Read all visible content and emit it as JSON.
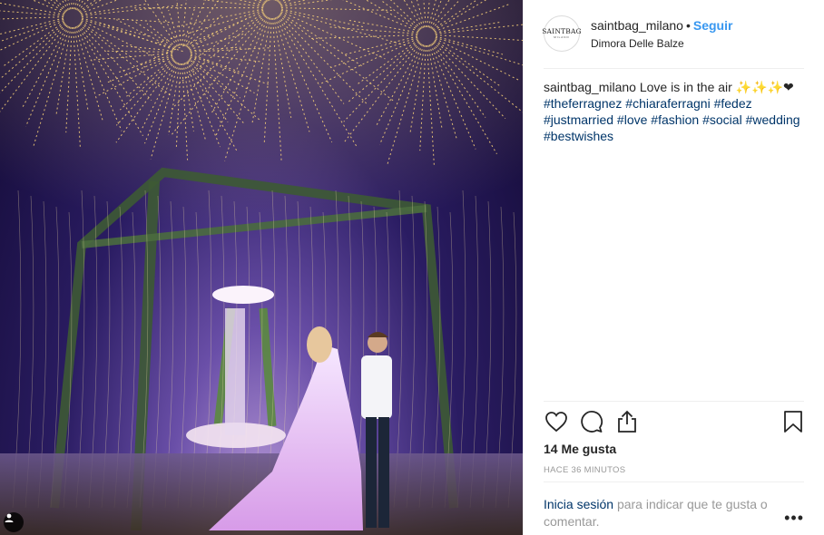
{
  "colors": {
    "link": "#003569",
    "follow": "#3897f0",
    "muted": "#999999",
    "text": "#262626"
  },
  "photo": {
    "tag_icon": "person-tag-icon"
  },
  "header": {
    "avatar_logo": "SAINTBAG",
    "avatar_sub": "MILANO",
    "username": "saintbag_milano",
    "separator": "•",
    "follow_label": "Seguir",
    "location": "Dimora Delle Balze"
  },
  "caption": {
    "username": "saintbag_milano",
    "text": "Love is in the air ✨✨✨❤",
    "hashtags": [
      "#theferragnez",
      "#chiaraferragni",
      "#fedez",
      "#justmarried",
      "#love",
      "#fashion",
      "#social",
      "#wedding",
      "#bestwishes"
    ]
  },
  "actions": {
    "like_icon": "heart-icon",
    "comment_icon": "comment-icon",
    "share_icon": "share-icon",
    "save_icon": "bookmark-icon"
  },
  "likes": "14 Me gusta",
  "timestamp": "HACE 36 MINUTOS",
  "login_prompt": {
    "link": "Inicia sesión",
    "text": "para indicar que te gusta o comentar."
  },
  "more_label": "•••"
}
